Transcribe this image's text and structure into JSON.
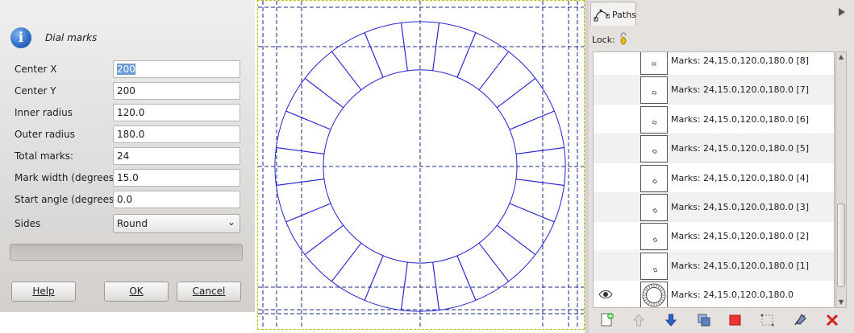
{
  "dialog": {
    "title": "Dial marks",
    "fields": [
      {
        "label": "Center X",
        "value": "200"
      },
      {
        "label": "Center Y",
        "value": "200"
      },
      {
        "label": "Inner radius",
        "value": "120.0"
      },
      {
        "label": "Outer radius",
        "value": "180.0"
      },
      {
        "label": "Total marks:",
        "value": "24"
      },
      {
        "label": "Mark width (degrees)",
        "value": "15.0"
      },
      {
        "label": "Start angle (degrees)",
        "value": "0.0"
      }
    ],
    "sides": {
      "label": "Sides",
      "value": "Round"
    },
    "buttons": {
      "help": "Help",
      "ok": "OK",
      "cancel": "Cancel"
    },
    "dial": {
      "marks": 24,
      "mark_width_deg": 15.0,
      "start_angle_deg": 0.0,
      "inner_radius": 120.0,
      "outer_radius": 180.0
    }
  },
  "paths_panel": {
    "tab_label": "Paths",
    "lock_label": "Lock:",
    "rows": [
      {
        "label": "Marks: 24,15.0,120.0,180.0 [8]",
        "visible": false
      },
      {
        "label": "Marks: 24,15.0,120.0,180.0 [7]",
        "visible": false
      },
      {
        "label": "Marks: 24,15.0,120.0,180.0 [6]",
        "visible": false
      },
      {
        "label": "Marks: 24,15.0,120.0,180.0 [5]",
        "visible": false
      },
      {
        "label": "Marks: 24,15.0,120.0,180.0 [4]",
        "visible": false
      },
      {
        "label": "Marks: 24,15.0,120.0,180.0 [3]",
        "visible": false
      },
      {
        "label": "Marks: 24,15.0,120.0,180.0 [2]",
        "visible": false
      },
      {
        "label": "Marks: 24,15.0,120.0,180.0 [1]",
        "visible": false
      },
      {
        "label": "Marks: 24,15.0,120.0,180.0",
        "visible": true
      }
    ],
    "toolbar": [
      "new-path-icon",
      "raise-path-icon",
      "lower-path-icon",
      "duplicate-path-icon",
      "path-to-selection-icon",
      "selection-to-path-icon",
      "paint-along-path-icon",
      "delete-path-icon"
    ]
  },
  "colors": {
    "path": "#2424d4",
    "guide": "#1a2a8a",
    "accent": "#6b9bd6",
    "delete": "#d02020"
  }
}
